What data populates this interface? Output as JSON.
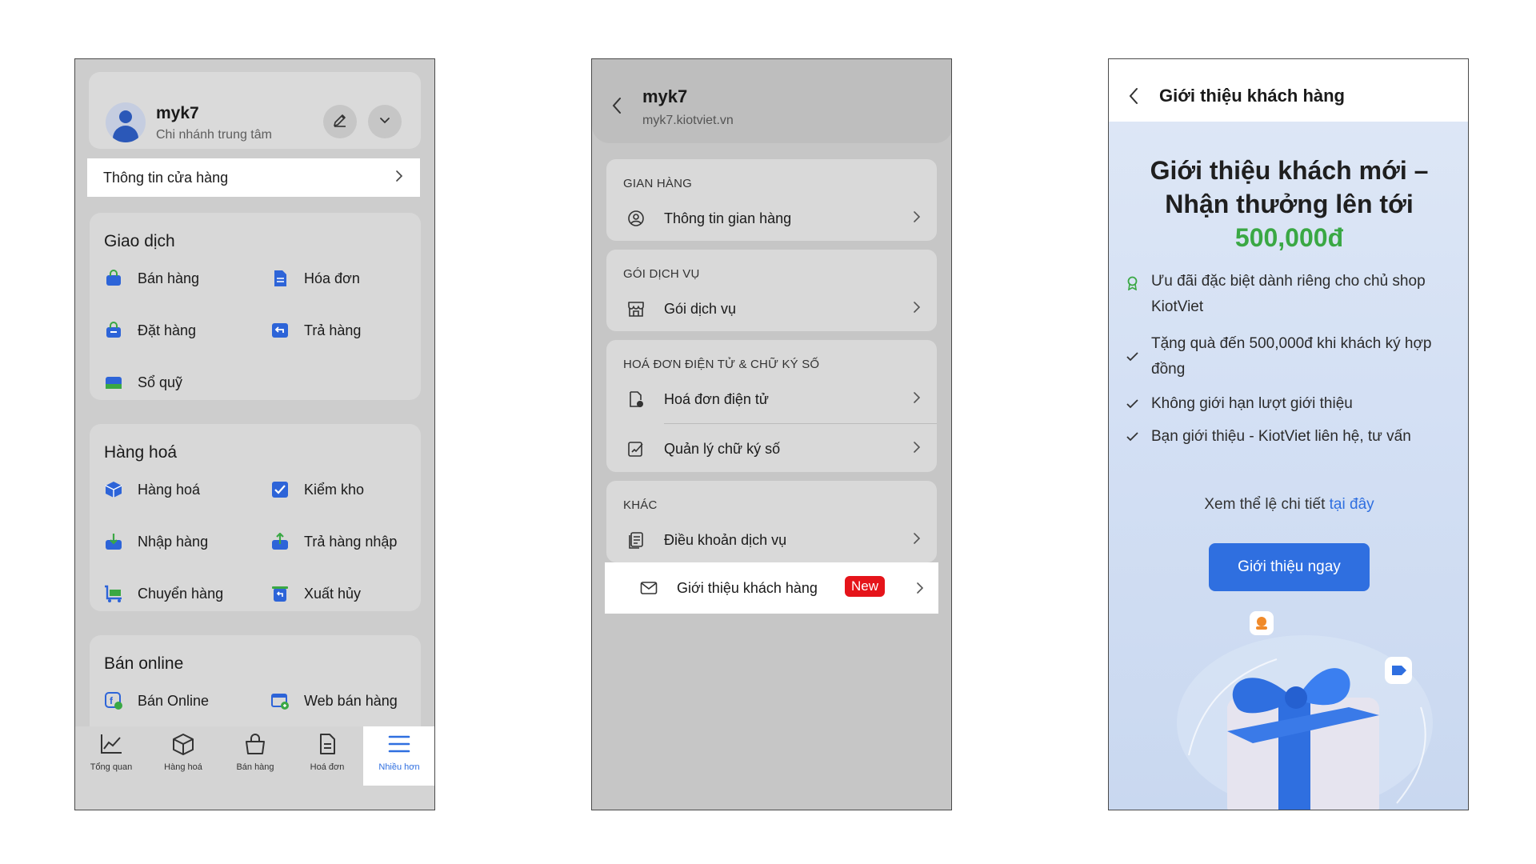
{
  "screen1": {
    "store_name": "myk7",
    "branch": "Chi nhánh trung tâm",
    "store_info_label": "Thông tin cửa hàng",
    "sections": [
      {
        "title": "Giao dịch",
        "items": [
          "Bán hàng",
          "Hóa đơn",
          "Đặt hàng",
          "Trả hàng",
          "Sổ quỹ"
        ]
      },
      {
        "title": "Hàng hoá",
        "items": [
          "Hàng hoá",
          "Kiểm kho",
          "Nhập hàng",
          "Trả hàng nhập",
          "Chuyển hàng",
          "Xuất hủy"
        ]
      },
      {
        "title": "Bán online",
        "items": [
          "Bán Online",
          "Web bán hàng"
        ]
      }
    ],
    "tabs": [
      "Tổng quan",
      "Hàng hoá",
      "Bán hàng",
      "Hoá đơn",
      "Nhiều hơn"
    ],
    "active_tab": "Nhiều hơn"
  },
  "screen2": {
    "title": "myk7",
    "subtitle": "myk7.kiotviet.vn",
    "groups": [
      {
        "caption": "GIAN HÀNG",
        "rows": [
          "Thông tin gian hàng"
        ]
      },
      {
        "caption": "GÓI DỊCH VỤ",
        "rows": [
          "Gói dịch vụ"
        ]
      },
      {
        "caption": "HOÁ ĐƠN ĐIỆN TỬ & CHỮ KÝ SỐ",
        "rows": [
          "Hoá đơn điện tử",
          "Quản lý chữ ký số"
        ]
      },
      {
        "caption": "KHÁC",
        "rows": [
          "Điều khoản dịch vụ",
          "Giới thiệu khách hàng"
        ]
      }
    ],
    "new_badge": "New"
  },
  "screen3": {
    "title": "Giới thiệu khách hàng",
    "headline_1": "Giới thiệu khách mới –",
    "headline_2": "Nhận thưởng lên tới",
    "amount": "500,000đ",
    "benefits": [
      "Ưu đãi đặc biệt dành riêng cho chủ shop KiotViet",
      "Tặng quà đến 500,000đ khi khách ký hợp đồng",
      "Không giới hạn lượt giới thiệu",
      "Bạn giới thiệu - KiotViet liên hệ, tư vấn"
    ],
    "more_text": "Xem thể lệ chi tiết",
    "more_link": "tại đây",
    "cta": "Giới thiệu ngay"
  },
  "colors": {
    "accent_blue": "#2f6fe0",
    "amount_green": "#3aa844",
    "badge_red": "#e5141a"
  }
}
